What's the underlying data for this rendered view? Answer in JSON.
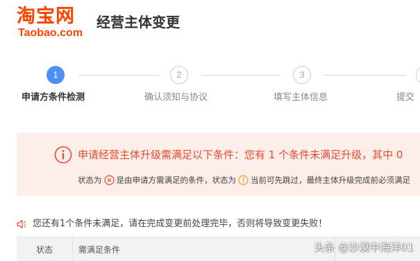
{
  "header": {
    "logo_cn": "淘宝网",
    "logo_en": "Taobao.com",
    "title": "经营主体变更"
  },
  "steps": [
    {
      "number": "1",
      "label": "申请方条件检测",
      "state": "active"
    },
    {
      "number": "2",
      "label": "确认须知与协议",
      "state": "todo"
    },
    {
      "number": "3",
      "label": "填写主体信息",
      "state": "todo"
    },
    {
      "number": "4",
      "label": "提交",
      "state": "todo"
    }
  ],
  "notice": {
    "main": "申请经营主体升级需满足以下条件：您有 1 个条件未满足升级，其中 0",
    "legend_prefix": "状态为",
    "legend_mid": "是由申请方需满足的条件，状态为",
    "legend_suffix": "当前可先跳过，最终主体升级完成前必须满足",
    "colors": {
      "accent": "#e44b30",
      "bg": "#fdeeea",
      "warn_orange": "#f0a020"
    }
  },
  "warning_line": "您还有1个条件未满足，请在完成变更前处理完毕，否则将导致变更失败！",
  "table": {
    "columns": [
      "状态",
      "需满足条件"
    ]
  },
  "watermark": "头条 @沙漠中海洋01"
}
